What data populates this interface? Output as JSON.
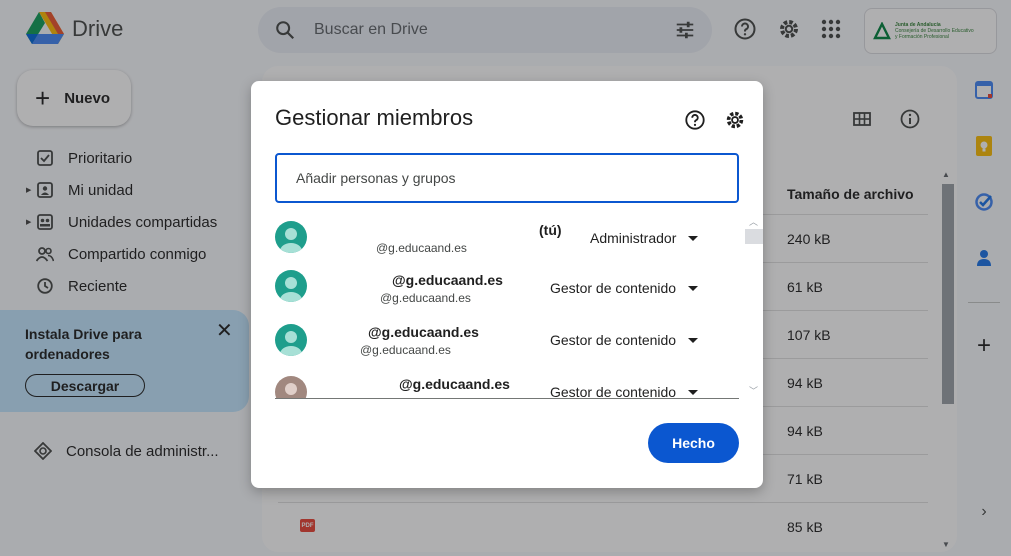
{
  "app": {
    "name": "Drive"
  },
  "search": {
    "placeholder": "Buscar en Drive"
  },
  "org_badge": {
    "line1": "Junta de Andalucía",
    "line2": "Consejería de Desarrollo Educativo",
    "line3": "y Formación Profesional"
  },
  "sidebar": {
    "new_label": "Nuevo",
    "items": [
      {
        "label": "Prioritario",
        "icon": "check-square-icon"
      },
      {
        "label": "Mi unidad",
        "icon": "my-drive-icon"
      },
      {
        "label": "Unidades compartidas",
        "icon": "shared-drives-icon"
      },
      {
        "label": "Compartido conmigo",
        "icon": "people-icon"
      },
      {
        "label": "Reciente",
        "icon": "clock-icon"
      }
    ],
    "promo": {
      "title": "Instala Drive para ordenadores",
      "button": "Descargar"
    },
    "admin_label": "Consola de administr..."
  },
  "table": {
    "size_header": "Tamaño de archivo",
    "sizes": [
      "240 kB",
      "61 kB",
      "107 kB",
      "94 kB",
      "94 kB",
      "71 kB",
      "85 kB"
    ],
    "pdf_label": "PDF"
  },
  "dialog": {
    "title": "Gestionar miembros",
    "input_placeholder": "Añadir personas y grupos",
    "done_label": "Hecho",
    "members": [
      {
        "name": "(tú)",
        "email": "@g.educaand.es",
        "role": "Administrador",
        "avatar_color": "#1e9e8c"
      },
      {
        "name": "@g.educaand.es",
        "email": "@g.educaand.es",
        "role": "Gestor de contenido",
        "avatar_color": "#1e9e8c"
      },
      {
        "name": "@g.educaand.es",
        "email": "@g.educaand.es",
        "role": "Gestor de contenido",
        "avatar_color": "#1e9e8c"
      },
      {
        "name": "@g.educaand.es",
        "email": "@g.educaand.es",
        "role": "Gestor de contenido",
        "avatar_color": "#a1887f"
      }
    ]
  },
  "colors": {
    "accent": "#0b57d0",
    "promo_bg": "#c2e7ff"
  }
}
